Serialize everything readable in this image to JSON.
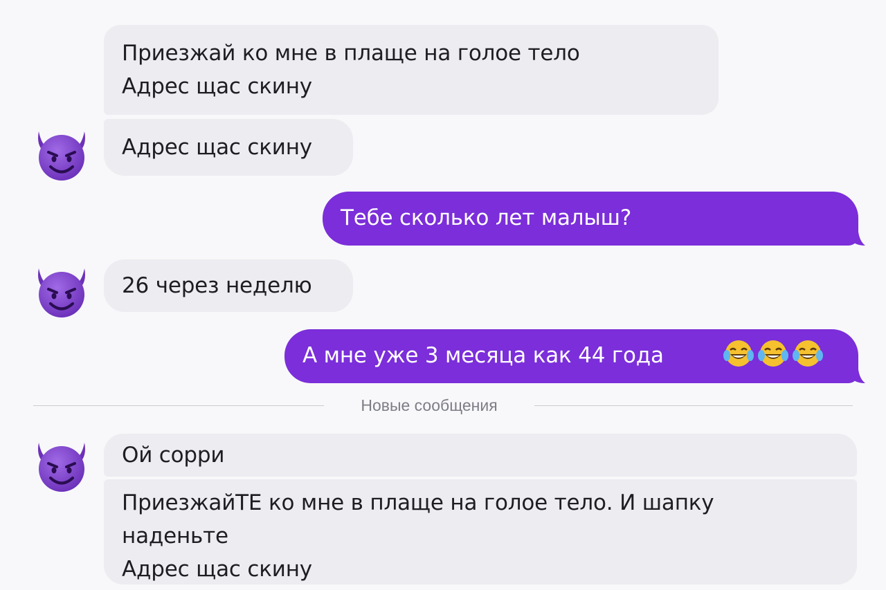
{
  "messages": [
    {
      "id": "b1",
      "direction": "incoming",
      "lines": [
        "Приезжай ко мне в плаще на голое тело",
        "Адрес щас скину"
      ]
    },
    {
      "id": "b2",
      "direction": "incoming",
      "lines": [
        "Адрес щас скину"
      ]
    },
    {
      "id": "b3",
      "direction": "outgoing",
      "lines": [
        "Тебе сколько лет малыш?"
      ]
    },
    {
      "id": "b4",
      "direction": "incoming",
      "lines": [
        "26 через неделю"
      ]
    },
    {
      "id": "b5",
      "direction": "outgoing",
      "lines": [
        "А мне уже 3 месяца как 44 года"
      ],
      "emojis": [
        "face-with-tears-of-joy",
        "face-with-tears-of-joy",
        "face-with-tears-of-joy"
      ]
    },
    {
      "id": "b6",
      "direction": "incoming",
      "lines": [
        "Ой сорри"
      ]
    },
    {
      "id": "b7",
      "direction": "incoming",
      "lines": [
        "ПриезжайТЕ ко мне в плаще на голое тело. И шапку",
        "наденьте",
        "Адрес щас скину"
      ]
    }
  ],
  "divider": {
    "label": "Новые сообщения"
  },
  "avatar": {
    "icon": "smiling-devil-emoji",
    "color": "#7b3fc7"
  },
  "colors": {
    "background": "#f8f8fa",
    "incoming_bubble": "#ececf1",
    "outgoing_bubble": "#7b2ed9",
    "outgoing_text": "#ffffff"
  }
}
